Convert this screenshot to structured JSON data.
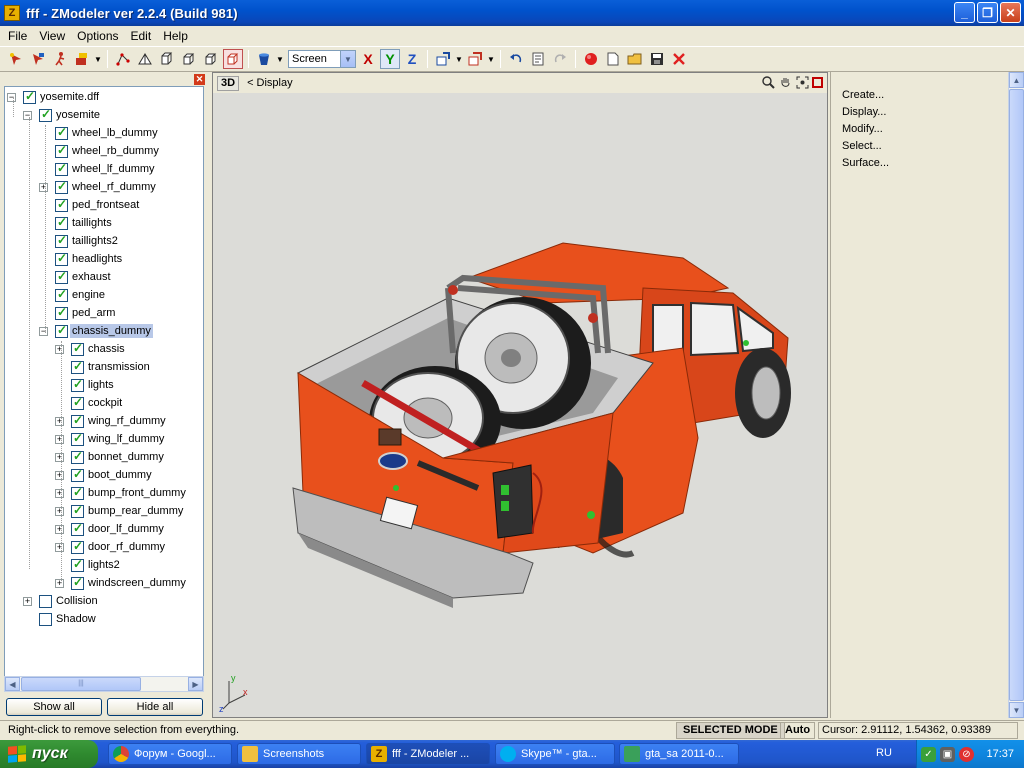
{
  "window": {
    "title": "fff - ZModeler ver 2.2.4 (Build 981)",
    "icon": "zmodeler-icon",
    "controls": {
      "minimize": "_",
      "maximize": "❐",
      "close": "✕"
    }
  },
  "menu": {
    "items": [
      {
        "label": "File"
      },
      {
        "label": "View"
      },
      {
        "label": "Options"
      },
      {
        "label": "Edit"
      },
      {
        "label": "Help"
      }
    ]
  },
  "toolbar": {
    "coord_system": "Screen",
    "axes": {
      "x": "X",
      "y": "Y",
      "z": "Z"
    }
  },
  "tree": {
    "root": "yosemite.dff",
    "model": "yosemite",
    "level1": [
      "wheel_lb_dummy",
      "wheel_rb_dummy",
      "wheel_lf_dummy",
      "wheel_rf_dummy",
      "ped_frontseat",
      "taillights",
      "taillights2",
      "headlights",
      "exhaust",
      "engine",
      "ped_arm",
      "chassis_dummy"
    ],
    "level2": [
      "chassis",
      "transmission",
      "lights",
      "cockpit",
      "wing_rf_dummy",
      "wing_lf_dummy",
      "bonnet_dummy",
      "boot_dummy",
      "bump_front_dummy",
      "bump_rear_dummy",
      "door_lf_dummy",
      "door_rf_dummy",
      "lights2",
      "windscreen_dummy"
    ],
    "extra": [
      "Collision",
      "Shadow"
    ],
    "selected": "chassis_dummy",
    "show_all": "Show all",
    "hide_all": "Hide all"
  },
  "viewport": {
    "mode": "3D",
    "display": "< Display",
    "gizmo": {
      "y": "y",
      "x": "x",
      "z": "z"
    }
  },
  "commands": [
    "Create...",
    "Display...",
    "Modify...",
    "Select...",
    "Surface..."
  ],
  "status": {
    "hint": "Right-click to remove selection from everything.",
    "mode": "SELECTED MODE",
    "auto": "Auto",
    "cursor": "Cursor: 2.91112, 1.54362, 0.93389"
  },
  "taskbar": {
    "start": "пуск",
    "tasks": [
      "Форум - Googl...",
      "Screenshots",
      "fff - ZModeler ...",
      "Skype™ - gta...",
      "gta_sa 2011-0..."
    ],
    "lang": "RU",
    "clock": "17:37"
  },
  "colors": {
    "truck_body": "#e8501c",
    "titlebar": "#0a5fd8",
    "tree_check": "#21a121"
  }
}
